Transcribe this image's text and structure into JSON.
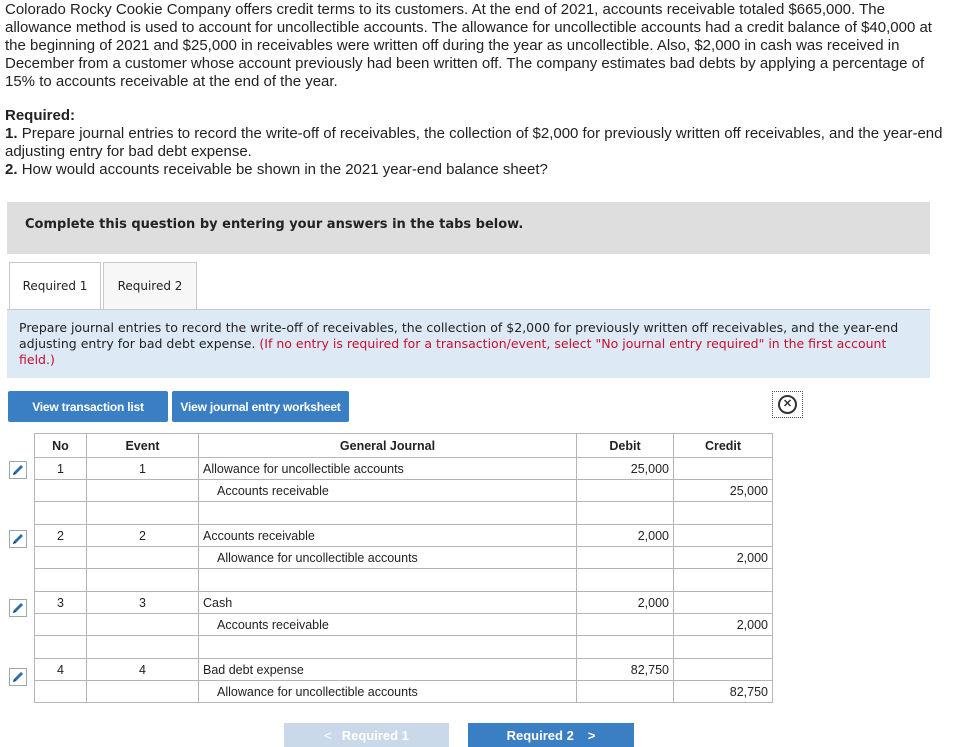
{
  "problem": {
    "text": "Colorado Rocky Cookie Company offers credit terms to its customers. At the end of 2021, accounts receivable totaled $665,000. The allowance method is used to account for uncollectible accounts. The allowance for uncollectible accounts had a credit balance of $40,000 at the beginning of 2021 and $25,000 in receivables were written off during the year as uncollectible. Also, $2,000 in cash was received in December from a customer whose account previously had been written off. The company estimates bad debts by applying a percentage of 15% to accounts receivable at the end of the year."
  },
  "required": {
    "heading": "Required:",
    "item1_num": "1.",
    "item1_text": "Prepare journal entries to record the write-off of receivables, the collection of $2,000 for previously written off receivables, and the year-end adjusting entry for bad debt expense.",
    "item2_num": "2.",
    "item2_text": "How would accounts receivable be shown in the 2021 year-end balance sheet?"
  },
  "instruction_bar": "Complete this question by entering your answers in the tabs below.",
  "tabs": [
    {
      "label": "Required 1"
    },
    {
      "label": "Required 2"
    }
  ],
  "prompt": {
    "text": "Prepare journal entries to record the write-off of receivables, the collection of $2,000 for previously written off receivables, and the year-end adjusting entry for bad debt expense.",
    "note": "(If no entry is required for a transaction/event, select \"No journal entry required\" in the first account field.)"
  },
  "buttons": {
    "view_list": "View transaction list",
    "view_worksheet": "View journal entry worksheet",
    "close_icon": "circle-x-icon"
  },
  "table": {
    "headers": {
      "no": "No",
      "event": "Event",
      "journal": "General Journal",
      "debit": "Debit",
      "credit": "Credit"
    },
    "entries": [
      {
        "no": "1",
        "event": "1",
        "debit_account": "Allowance for uncollectible accounts",
        "debit": "25,000",
        "credit_account": "Accounts receivable",
        "credit": "25,000"
      },
      {
        "no": "2",
        "event": "2",
        "debit_account": "Accounts receivable",
        "debit": "2,000",
        "credit_account": "Allowance for uncollectible accounts",
        "credit": "2,000"
      },
      {
        "no": "3",
        "event": "3",
        "debit_account": "Cash",
        "debit": "2,000",
        "credit_account": "Accounts receivable",
        "credit": "2,000"
      },
      {
        "no": "4",
        "event": "4",
        "debit_account": "Bad debt expense",
        "debit": "82,750",
        "credit_account": "Allowance for uncollectible accounts",
        "credit": "82,750"
      }
    ]
  },
  "nav": {
    "prev_label": "Required 1",
    "next_label": "Required 2",
    "prev_chevron": "<",
    "next_chevron": ">"
  },
  "colors": {
    "accent": "#3a7fc3",
    "note_red": "#c8102e",
    "prompt_bg": "#dde9f5"
  }
}
